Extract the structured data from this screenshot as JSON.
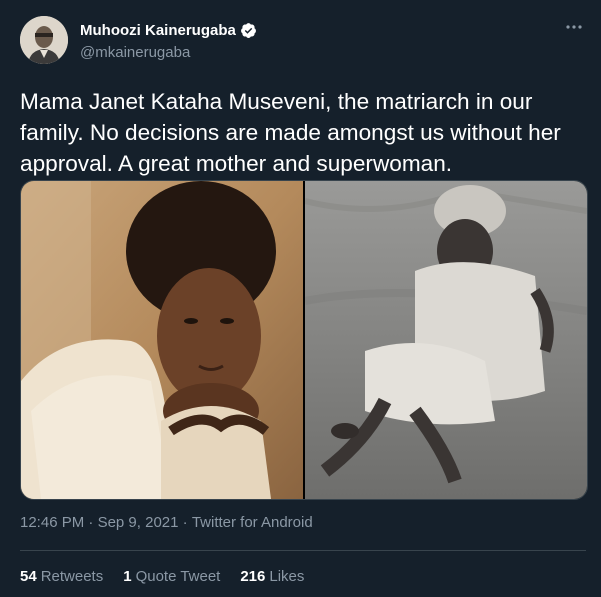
{
  "author": {
    "name": "Muhoozi Kainerugaba",
    "handle": "@mkainerugaba"
  },
  "tweet": {
    "text": "Mama Janet Kataha Museveni, the matriarch in our family. No decisions are made amongst us without her approval. A great mother and superwoman."
  },
  "meta": {
    "time": "12:46 PM",
    "separator1": " · ",
    "date": "Sep 9, 2021",
    "separator2": " · ",
    "source": "Twitter for Android"
  },
  "stats": {
    "retweets_count": "54",
    "retweets_label": "Retweets",
    "quotes_count": "1",
    "quotes_label": "Quote Tweet",
    "likes_count": "216",
    "likes_label": "Likes"
  },
  "colors": {
    "background": "#15202b",
    "secondary_text": "#8b98a5",
    "verified_blue": "#1d9bf0"
  },
  "icons": [
    "verified-badge-icon",
    "more-options-icon"
  ]
}
